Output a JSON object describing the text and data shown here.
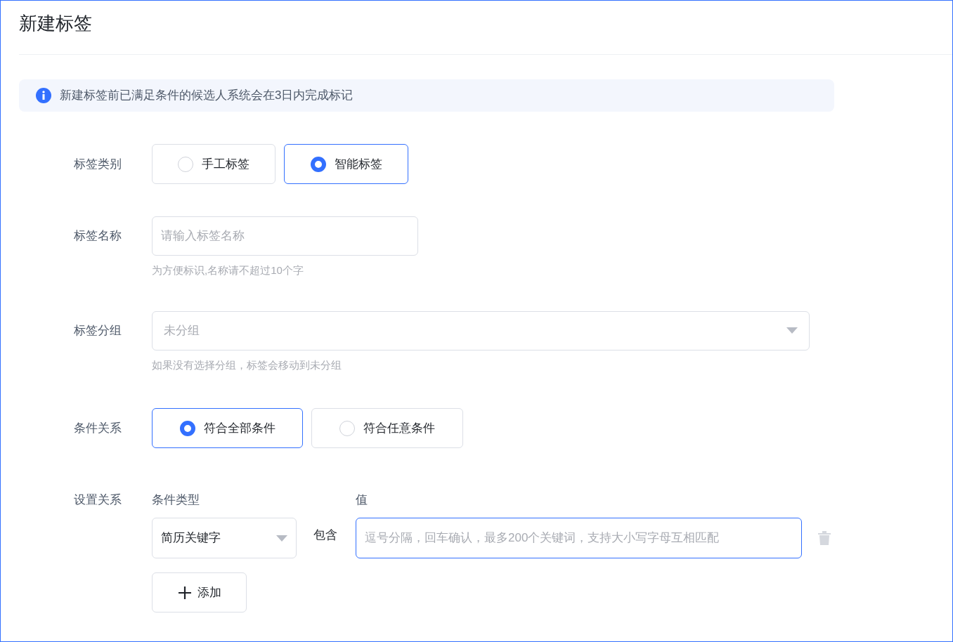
{
  "title": "新建标签",
  "alert": {
    "text": "新建标签前已满足条件的候选人系统会在3日内完成标记"
  },
  "tag_type": {
    "label": "标签类别",
    "options": [
      {
        "label": "手工标签",
        "selected": false
      },
      {
        "label": "智能标签",
        "selected": true
      }
    ]
  },
  "tag_name": {
    "label": "标签名称",
    "placeholder": "请输入标签名称",
    "hint": "为方便标识,名称请不超过10个字"
  },
  "tag_group": {
    "label": "标签分组",
    "value": "未分组",
    "hint": "如果没有选择分组，标签会移动到未分组"
  },
  "relation": {
    "label": "条件关系",
    "options": [
      {
        "label": "符合全部条件",
        "selected": true
      },
      {
        "label": "符合任意条件",
        "selected": false
      }
    ]
  },
  "setting": {
    "label": "设置关系",
    "type_header": "条件类型",
    "value_header": "值",
    "conditions": [
      {
        "type": "简历关键字",
        "operator": "包含",
        "placeholder": "逗号分隔，回车确认，最多200个关键词，支持大小写字母互相匹配",
        "focused": true
      }
    ],
    "add_button": "添加"
  }
}
